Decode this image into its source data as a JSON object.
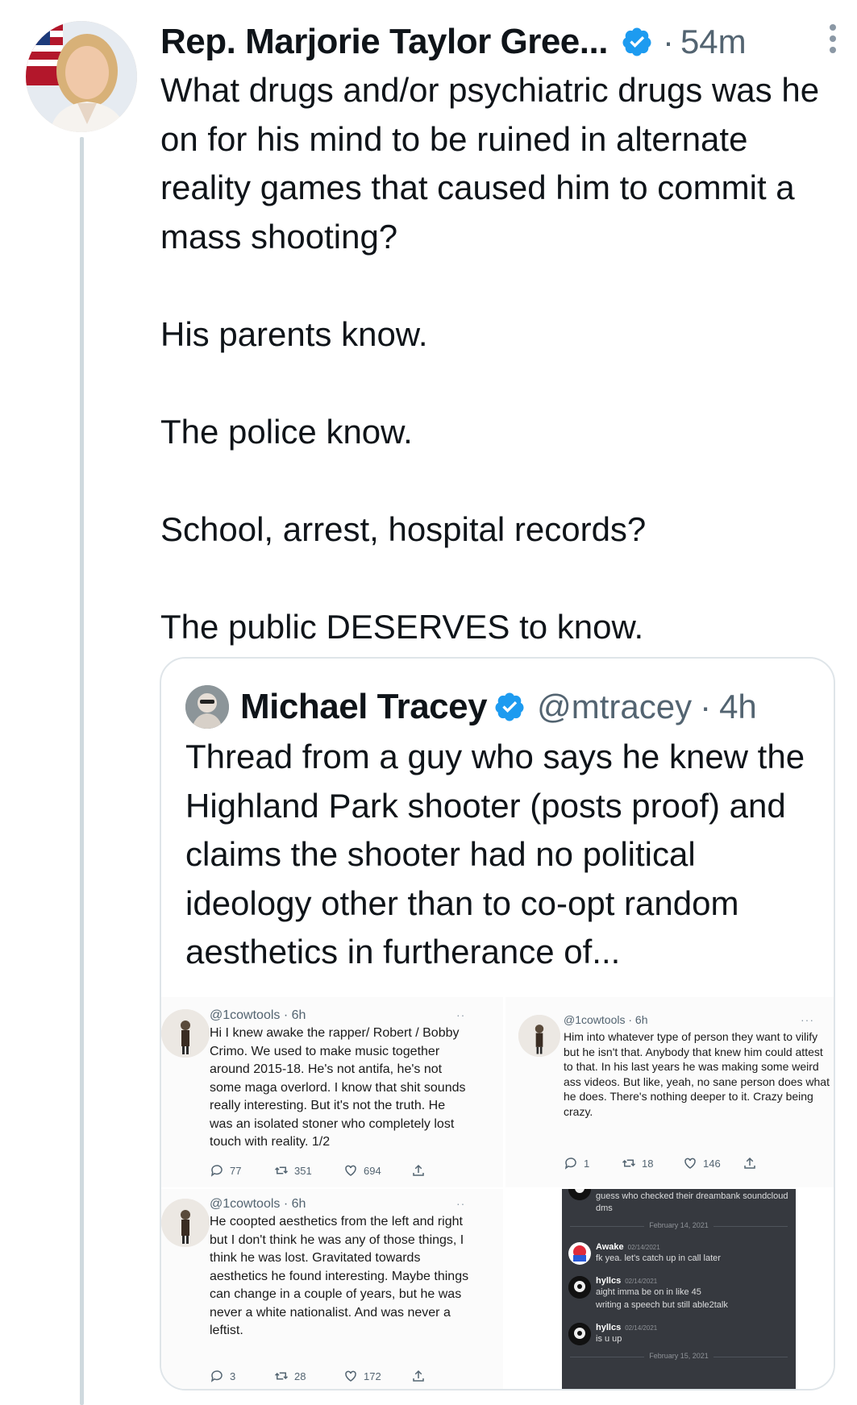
{
  "tweet": {
    "author": "Rep. Marjorie Taylor Gree...",
    "separator": "·",
    "time": "54m",
    "paragraphs": [
      "What drugs and/or psychiatric drugs was he on for his mind to be ruined in alternate reality games that caused him to commit a mass shooting?",
      "His parents know.",
      "The police know.",
      "School, arrest, hospital records?",
      "The public DESERVES to know."
    ]
  },
  "quote": {
    "author": "Michael Tracey",
    "handle": "@mtracey",
    "separator": "·",
    "time": "4h",
    "text": "Thread from a guy who says he knew the Highland Park shooter (posts proof) and claims the shooter had no political ideology other than to co-opt random aesthetics in furtherance of..."
  },
  "media": {
    "post1": {
      "handle": "@1cowtools · 6h",
      "more": "··",
      "text": "Hi I knew awake the rapper/ Robert / Bobby Crimo. We used to make music together around 2015-18. He's not antifa, he's not some maga overlord. I know that shit sounds really interesting. But it's not the truth. He was an isolated stoner who completely lost touch with reality. 1/2",
      "replies": "77",
      "retweets": "351",
      "likes": "694"
    },
    "post2": {
      "handle": "@1cowtools · 6h",
      "more": "···",
      "text": "Him into whatever type of person they want to vilify but he isn't that. Anybody that knew him could attest to that. In his last years he was making some weird ass videos. But like, yeah, no sane person does what he does. There's nothing deeper to it. Crazy being crazy.",
      "replies": "1",
      "retweets": "18",
      "likes": "146"
    },
    "post3": {
      "handle": "@1cowtools · 6h",
      "more": "··",
      "text": "He coopted aesthetics from the left and right but I don't think he was any of those things, I think he was lost. Gravitated towards aesthetics he found interesting. Maybe things can change in a couple of years, but he was never a white nationalist. And was never a leftist.",
      "replies": "3",
      "retweets": "28",
      "likes": "172"
    },
    "discord": {
      "top_message": "guess who checked their dreambank soundcloud dms",
      "date_1": "February 14, 2021",
      "messages": [
        {
          "user": "Awake",
          "time": "02/14/2021",
          "lines": [
            "fk yea. let's catch up in call later"
          ]
        },
        {
          "user": "hyllcs",
          "time": "02/14/2021",
          "lines": [
            "aight imma be on in like 45",
            "writing a speech but still able2talk"
          ]
        },
        {
          "user": "hyllcs",
          "time": "02/14/2021",
          "lines": [
            "is u up"
          ]
        }
      ],
      "date_2": "February 15, 2021"
    }
  },
  "colors": {
    "verified": "#1d9bf0",
    "secondary_text": "#536471",
    "thread_line": "#cfd9de",
    "discord_bg": "#36393f"
  },
  "icons": [
    "verified-badge-icon",
    "more-options-icon",
    "reply-icon",
    "retweet-icon",
    "like-icon",
    "share-icon"
  ]
}
